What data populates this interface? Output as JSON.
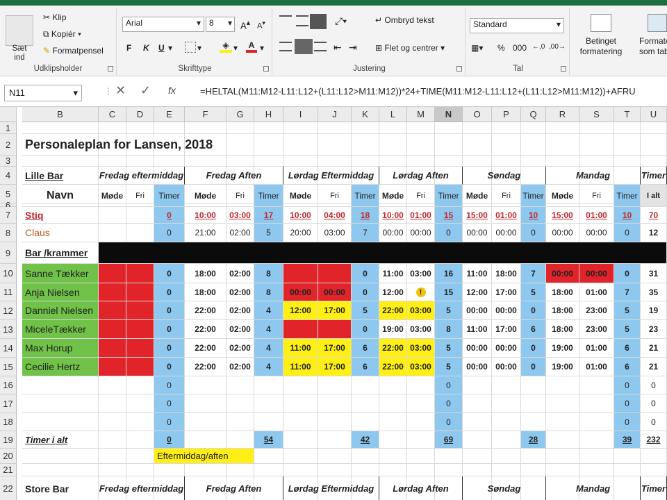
{
  "ribbon": {
    "clipboard": {
      "paste": "Sæt ind",
      "cut": "Klip",
      "copy": "Kopiér",
      "painter": "Formatpensel",
      "label": "Udklipsholder"
    },
    "font": {
      "name": "Arial",
      "size": "8",
      "grow": "A",
      "shrink": "A",
      "bold": "F",
      "italic": "K",
      "underline": "U",
      "color_letter": "A",
      "label": "Skrifttype"
    },
    "align": {
      "wrap": "Ombryd tekst",
      "merge": "Flet og centrer",
      "label": "Justering"
    },
    "number": {
      "format": "Standard",
      "percent": "%",
      "thousands": "000",
      "label": "Tal"
    },
    "styles": {
      "conditional": "Betinget formatering",
      "format_table": "Formatér som tabel"
    }
  },
  "namebox": "N11",
  "formula": "=HELTAL(M11:M12-L11:L12+(L11:L12>M11:M12))*24+TIME(M11:M12-L11:L12+(L11:L12>M11:M12))+AFRU",
  "columns": [
    "B",
    "C",
    "D",
    "E",
    "F",
    "G",
    "H",
    "I",
    "J",
    "K",
    "L",
    "M",
    "N",
    "O",
    "P",
    "Q",
    "R",
    "S",
    "T",
    "U"
  ],
  "rows": [
    "1",
    "2",
    "3",
    "4",
    "5",
    "6",
    "7",
    "8",
    "9",
    "10",
    "11",
    "12",
    "13",
    "14",
    "15",
    "16",
    "17",
    "18",
    "19",
    "20",
    "21",
    "22"
  ],
  "title": "Personaleplan for Lansen, 2018",
  "section1": "Lille Bar",
  "navn": "Navn",
  "bar_krammer": "Bar /krammer",
  "groups": [
    "Fredag eftermiddag",
    "Fredag Aften",
    "Lørdag Eftermiddag",
    "Lørdag Aften",
    "Søndag",
    "Mandag",
    "Timer"
  ],
  "sub": {
    "mode": "Møde",
    "fri": "Fri",
    "timer": "Timer",
    "ialt": "I alt"
  },
  "staff": [
    {
      "name": "Stiq",
      "vals": [
        "",
        "",
        "0",
        "10:00",
        "03:00",
        "17",
        "10:00",
        "04:00",
        "18",
        "10:00",
        "01:00",
        "15",
        "15:00",
        "01:00",
        "10",
        "15:00",
        "01:00",
        "10",
        "70"
      ]
    },
    {
      "name": "Claus",
      "vals": [
        "",
        "",
        "0",
        "21:00",
        "02:00",
        "5",
        "20:00",
        "03:00",
        "7",
        "00:00",
        "00:00",
        "0",
        "00:00",
        "00:00",
        "0",
        "00:00",
        "00:00",
        "0",
        "12"
      ]
    },
    {
      "name": "Sanne Tækker",
      "vals": [
        "",
        "",
        "0",
        "18:00",
        "02:00",
        "8",
        "",
        "",
        "0",
        "11:00",
        "03:00",
        "16",
        "11:00",
        "18:00",
        "7",
        "00:00",
        "00:00",
        "0",
        "31"
      ]
    },
    {
      "name": "Anja Nielsen",
      "vals": [
        "",
        "",
        "0",
        "18:00",
        "02:00",
        "8",
        "00:00",
        "00:00",
        "0",
        "12:00",
        "!",
        "15",
        "12:00",
        "17:00",
        "5",
        "18:00",
        "01:00",
        "7",
        "35"
      ]
    },
    {
      "name": "Danniel Nielsen",
      "vals": [
        "",
        "",
        "0",
        "22:00",
        "02:00",
        "4",
        "12:00",
        "17:00",
        "5",
        "22:00",
        "03:00",
        "5",
        "00:00",
        "00:00",
        "0",
        "18:00",
        "23:00",
        "5",
        "19"
      ]
    },
    {
      "name": "MiceleTækker",
      "vals": [
        "",
        "",
        "0",
        "22:00",
        "02:00",
        "4",
        "",
        "",
        "0",
        "19:00",
        "03:00",
        "8",
        "11:00",
        "17:00",
        "6",
        "18:00",
        "23:00",
        "5",
        "23"
      ]
    },
    {
      "name": "Max Horup",
      "vals": [
        "",
        "",
        "0",
        "22:00",
        "02:00",
        "4",
        "11:00",
        "17:00",
        "6",
        "22:00",
        "03:00",
        "5",
        "00:00",
        "00:00",
        "0",
        "19:00",
        "01:00",
        "6",
        "21"
      ]
    },
    {
      "name": "Cecilie Hertz",
      "vals": [
        "",
        "",
        "0",
        "22:00",
        "02:00",
        "4",
        "11:00",
        "17:00",
        "6",
        "22:00",
        "03:00",
        "5",
        "00:00",
        "00:00",
        "0",
        "19:00",
        "01:00",
        "6",
        "21"
      ]
    }
  ],
  "empty_rows": [
    {
      "vals": [
        "0",
        "0",
        "0",
        "0"
      ]
    },
    {
      "vals": [
        "0",
        "0",
        "0",
        "0"
      ]
    },
    {
      "vals": [
        "0",
        "0",
        "0",
        "0"
      ]
    }
  ],
  "totals": {
    "label": "Timer i alt",
    "vals": [
      "0",
      "54",
      "42",
      "69",
      "28",
      "39",
      "232"
    ]
  },
  "note20": "Eftermiddag/aften",
  "section2": "Store Bar",
  "colors": {
    "red": "#e0242a",
    "yellow": "#ffef14",
    "green": "#70c248",
    "blue": "#8fc8ee",
    "black": "#0b0b0b"
  }
}
